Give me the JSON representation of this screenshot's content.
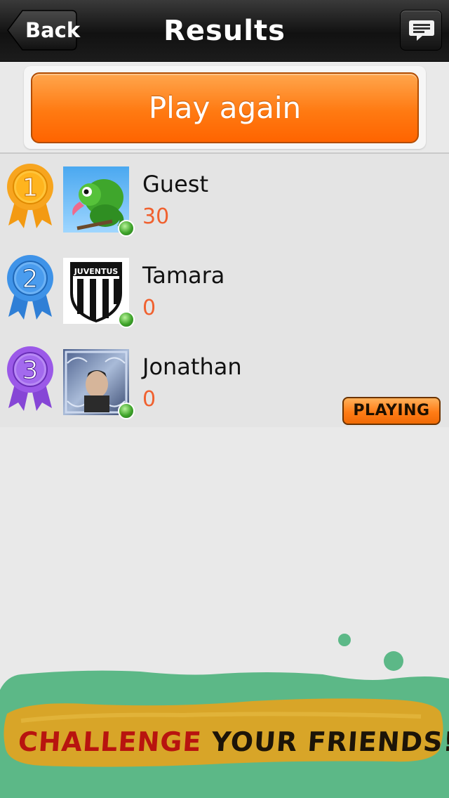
{
  "navbar": {
    "title": "Results",
    "back_label": "Back",
    "chat_icon": "chat-bubble-icon"
  },
  "actions": {
    "play_again_label": "Play again"
  },
  "players": [
    {
      "rank": "1",
      "name": "Guest",
      "score": "30",
      "ribbon_color": "#f7a51f",
      "avatar": "chameleon-avatar",
      "online": true,
      "status": ""
    },
    {
      "rank": "2",
      "name": "Tamara",
      "score": "0",
      "ribbon_color": "#3f93e8",
      "avatar": "juventus-logo-avatar",
      "online": true,
      "status": ""
    },
    {
      "rank": "3",
      "name": "Jonathan",
      "score": "0",
      "ribbon_color": "#9b59e8",
      "avatar": "person-photo-avatar",
      "online": true,
      "status": "PLAYING"
    }
  ],
  "banner": {
    "word1": "CHALLENGE",
    "word2": "YOUR FRIENDS!"
  },
  "colors": {
    "accent_orange": "#ff7a12",
    "score_color": "#f0612f",
    "banner_green": "#5cb887",
    "banner_gold": "#d8a528"
  }
}
